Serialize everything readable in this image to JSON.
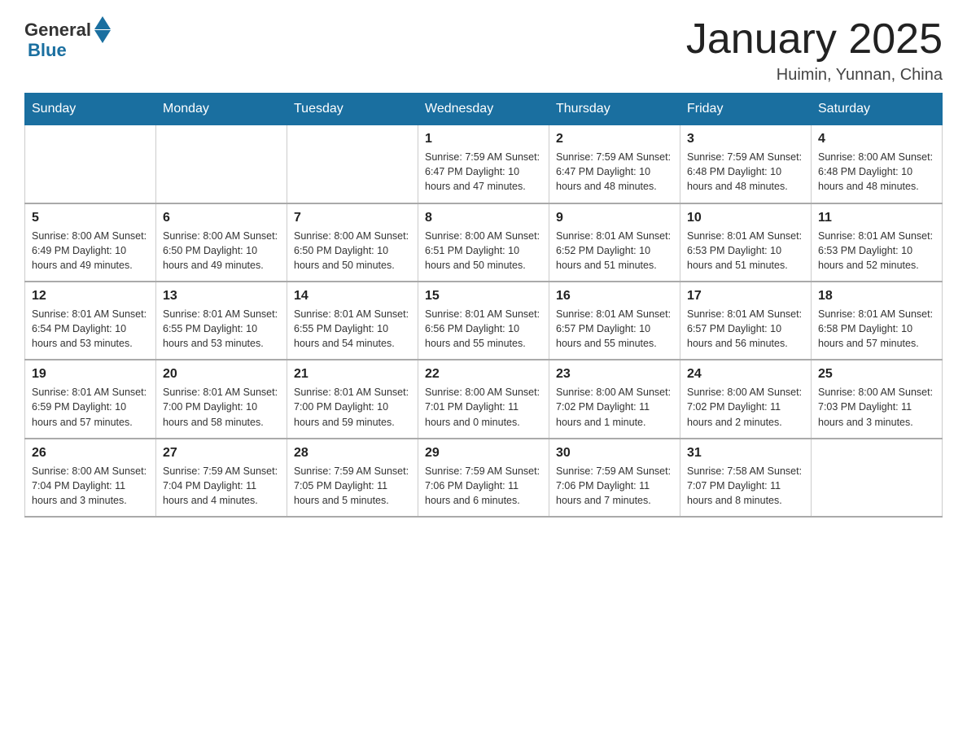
{
  "logo": {
    "general": "General",
    "blue": "Blue"
  },
  "title": "January 2025",
  "subtitle": "Huimin, Yunnan, China",
  "days_of_week": [
    "Sunday",
    "Monday",
    "Tuesday",
    "Wednesday",
    "Thursday",
    "Friday",
    "Saturday"
  ],
  "weeks": [
    [
      {
        "day": "",
        "info": ""
      },
      {
        "day": "",
        "info": ""
      },
      {
        "day": "",
        "info": ""
      },
      {
        "day": "1",
        "info": "Sunrise: 7:59 AM\nSunset: 6:47 PM\nDaylight: 10 hours\nand 47 minutes."
      },
      {
        "day": "2",
        "info": "Sunrise: 7:59 AM\nSunset: 6:47 PM\nDaylight: 10 hours\nand 48 minutes."
      },
      {
        "day": "3",
        "info": "Sunrise: 7:59 AM\nSunset: 6:48 PM\nDaylight: 10 hours\nand 48 minutes."
      },
      {
        "day": "4",
        "info": "Sunrise: 8:00 AM\nSunset: 6:48 PM\nDaylight: 10 hours\nand 48 minutes."
      }
    ],
    [
      {
        "day": "5",
        "info": "Sunrise: 8:00 AM\nSunset: 6:49 PM\nDaylight: 10 hours\nand 49 minutes."
      },
      {
        "day": "6",
        "info": "Sunrise: 8:00 AM\nSunset: 6:50 PM\nDaylight: 10 hours\nand 49 minutes."
      },
      {
        "day": "7",
        "info": "Sunrise: 8:00 AM\nSunset: 6:50 PM\nDaylight: 10 hours\nand 50 minutes."
      },
      {
        "day": "8",
        "info": "Sunrise: 8:00 AM\nSunset: 6:51 PM\nDaylight: 10 hours\nand 50 minutes."
      },
      {
        "day": "9",
        "info": "Sunrise: 8:01 AM\nSunset: 6:52 PM\nDaylight: 10 hours\nand 51 minutes."
      },
      {
        "day": "10",
        "info": "Sunrise: 8:01 AM\nSunset: 6:53 PM\nDaylight: 10 hours\nand 51 minutes."
      },
      {
        "day": "11",
        "info": "Sunrise: 8:01 AM\nSunset: 6:53 PM\nDaylight: 10 hours\nand 52 minutes."
      }
    ],
    [
      {
        "day": "12",
        "info": "Sunrise: 8:01 AM\nSunset: 6:54 PM\nDaylight: 10 hours\nand 53 minutes."
      },
      {
        "day": "13",
        "info": "Sunrise: 8:01 AM\nSunset: 6:55 PM\nDaylight: 10 hours\nand 53 minutes."
      },
      {
        "day": "14",
        "info": "Sunrise: 8:01 AM\nSunset: 6:55 PM\nDaylight: 10 hours\nand 54 minutes."
      },
      {
        "day": "15",
        "info": "Sunrise: 8:01 AM\nSunset: 6:56 PM\nDaylight: 10 hours\nand 55 minutes."
      },
      {
        "day": "16",
        "info": "Sunrise: 8:01 AM\nSunset: 6:57 PM\nDaylight: 10 hours\nand 55 minutes."
      },
      {
        "day": "17",
        "info": "Sunrise: 8:01 AM\nSunset: 6:57 PM\nDaylight: 10 hours\nand 56 minutes."
      },
      {
        "day": "18",
        "info": "Sunrise: 8:01 AM\nSunset: 6:58 PM\nDaylight: 10 hours\nand 57 minutes."
      }
    ],
    [
      {
        "day": "19",
        "info": "Sunrise: 8:01 AM\nSunset: 6:59 PM\nDaylight: 10 hours\nand 57 minutes."
      },
      {
        "day": "20",
        "info": "Sunrise: 8:01 AM\nSunset: 7:00 PM\nDaylight: 10 hours\nand 58 minutes."
      },
      {
        "day": "21",
        "info": "Sunrise: 8:01 AM\nSunset: 7:00 PM\nDaylight: 10 hours\nand 59 minutes."
      },
      {
        "day": "22",
        "info": "Sunrise: 8:00 AM\nSunset: 7:01 PM\nDaylight: 11 hours\nand 0 minutes."
      },
      {
        "day": "23",
        "info": "Sunrise: 8:00 AM\nSunset: 7:02 PM\nDaylight: 11 hours\nand 1 minute."
      },
      {
        "day": "24",
        "info": "Sunrise: 8:00 AM\nSunset: 7:02 PM\nDaylight: 11 hours\nand 2 minutes."
      },
      {
        "day": "25",
        "info": "Sunrise: 8:00 AM\nSunset: 7:03 PM\nDaylight: 11 hours\nand 3 minutes."
      }
    ],
    [
      {
        "day": "26",
        "info": "Sunrise: 8:00 AM\nSunset: 7:04 PM\nDaylight: 11 hours\nand 3 minutes."
      },
      {
        "day": "27",
        "info": "Sunrise: 7:59 AM\nSunset: 7:04 PM\nDaylight: 11 hours\nand 4 minutes."
      },
      {
        "day": "28",
        "info": "Sunrise: 7:59 AM\nSunset: 7:05 PM\nDaylight: 11 hours\nand 5 minutes."
      },
      {
        "day": "29",
        "info": "Sunrise: 7:59 AM\nSunset: 7:06 PM\nDaylight: 11 hours\nand 6 minutes."
      },
      {
        "day": "30",
        "info": "Sunrise: 7:59 AM\nSunset: 7:06 PM\nDaylight: 11 hours\nand 7 minutes."
      },
      {
        "day": "31",
        "info": "Sunrise: 7:58 AM\nSunset: 7:07 PM\nDaylight: 11 hours\nand 8 minutes."
      },
      {
        "day": "",
        "info": ""
      }
    ]
  ]
}
